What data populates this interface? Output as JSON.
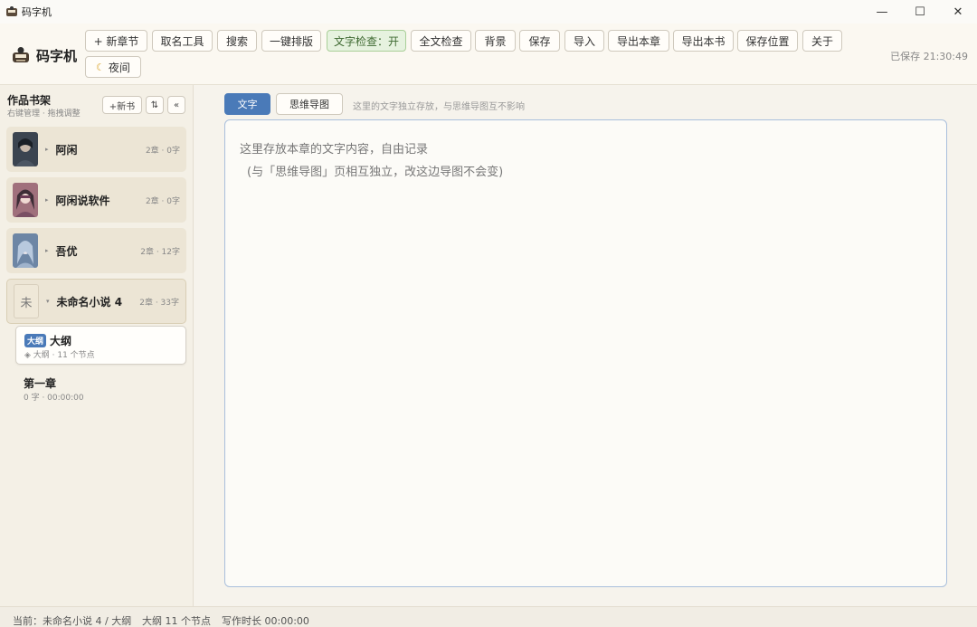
{
  "window": {
    "title": "码字机",
    "controls": {
      "minimize": "—",
      "maximize": "☐",
      "close": "✕"
    }
  },
  "toolbar": {
    "brand": "码字机",
    "buttons": {
      "new_chapter": "+ 新章节",
      "naming_tool": "取名工具",
      "search": "搜索",
      "one_click_layout": "一键排版",
      "text_check": "文字检查：开",
      "full_check": "全文检查",
      "background": "背景",
      "save": "保存",
      "import": "导入",
      "export_chapter": "导出本章",
      "export_book": "导出本书",
      "save_location": "保存位置",
      "about": "关于",
      "night": "夜间"
    },
    "saved_status": "已保存 21:30:49"
  },
  "sidebar": {
    "title": "作品书架",
    "subtitle": "右键管理 · 拖拽调整",
    "new_book": "+新书",
    "sort": "⇅",
    "collapse": "«",
    "books": [
      {
        "name": "阿闲",
        "meta": "2章 · 0字",
        "cover_color": "#3b4450"
      },
      {
        "name": "阿闲说软件",
        "meta": "2章 · 0字",
        "cover_color": "#a0707c"
      },
      {
        "name": "吾优",
        "meta": "2章 · 12字",
        "cover_color": "#6d86a5"
      },
      {
        "name": "未命名小说 4",
        "meta": "2章 · 33字",
        "cover_text": "未"
      }
    ],
    "chapters": [
      {
        "tag": "大纲",
        "title": "大纲",
        "meta": "◈ 大纲 · 11 个节点"
      },
      {
        "title": "第一章",
        "meta": "0 字 · 00:00:00"
      }
    ]
  },
  "main": {
    "tabs": {
      "text": "文字",
      "mindmap": "思维导图"
    },
    "tab_hint": "这里的文字独立存放，与思维导图互不影响",
    "editor_placeholder_1": "这里存放本章的文字内容，自由记录",
    "editor_placeholder_2": "(与「思维导图」页相互独立，改这边导图不会变)"
  },
  "statusbar": {
    "current": "当前：未命名小说 4 / 大纲",
    "outline": "大纲 11 个节点",
    "writing_time": "写作时长 00:00:00"
  }
}
